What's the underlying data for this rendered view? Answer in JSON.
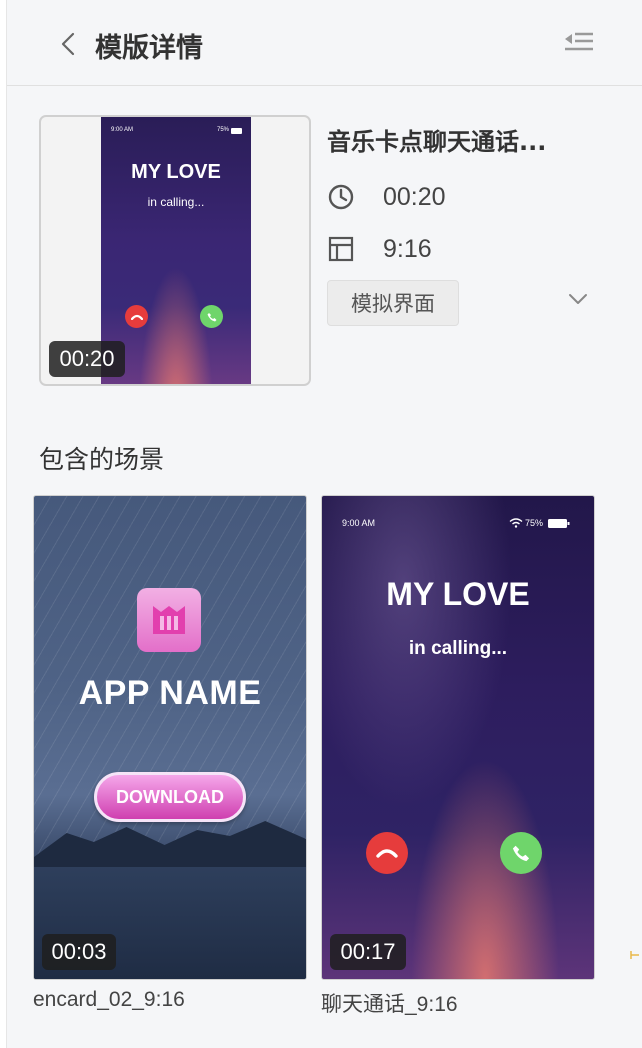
{
  "header": {
    "title": "模版详情",
    "back_icon": "chevron-left-icon",
    "collapse_icon": "collapse-panel-icon"
  },
  "template": {
    "name": "音乐卡点聊天通话...",
    "duration": "00:20",
    "ratio": "9:16",
    "tag": "模拟界面",
    "cover_duration_badge": "00:20",
    "cover_preview": {
      "status_time": "9:00 AM",
      "battery": "75%",
      "title": "MY LOVE",
      "subtitle": "in calling..."
    }
  },
  "scenes_section": {
    "title": "包含的场景",
    "scenes": [
      {
        "label": "encard_02_9:16",
        "duration": "00:03",
        "preview": {
          "app_name": "APP NAME",
          "button": "DOWNLOAD"
        }
      },
      {
        "label": "聊天通话_9:16",
        "duration": "00:17",
        "preview": {
          "status_time": "9:00 AM",
          "battery": "75%",
          "title": "MY LOVE",
          "subtitle": "in calling..."
        }
      }
    ]
  },
  "colors": {
    "panel_bg": "#f5f6f8",
    "call_red": "#e63c3c",
    "call_green": "#6fd56b",
    "download_pink": "#cf3fb0"
  }
}
